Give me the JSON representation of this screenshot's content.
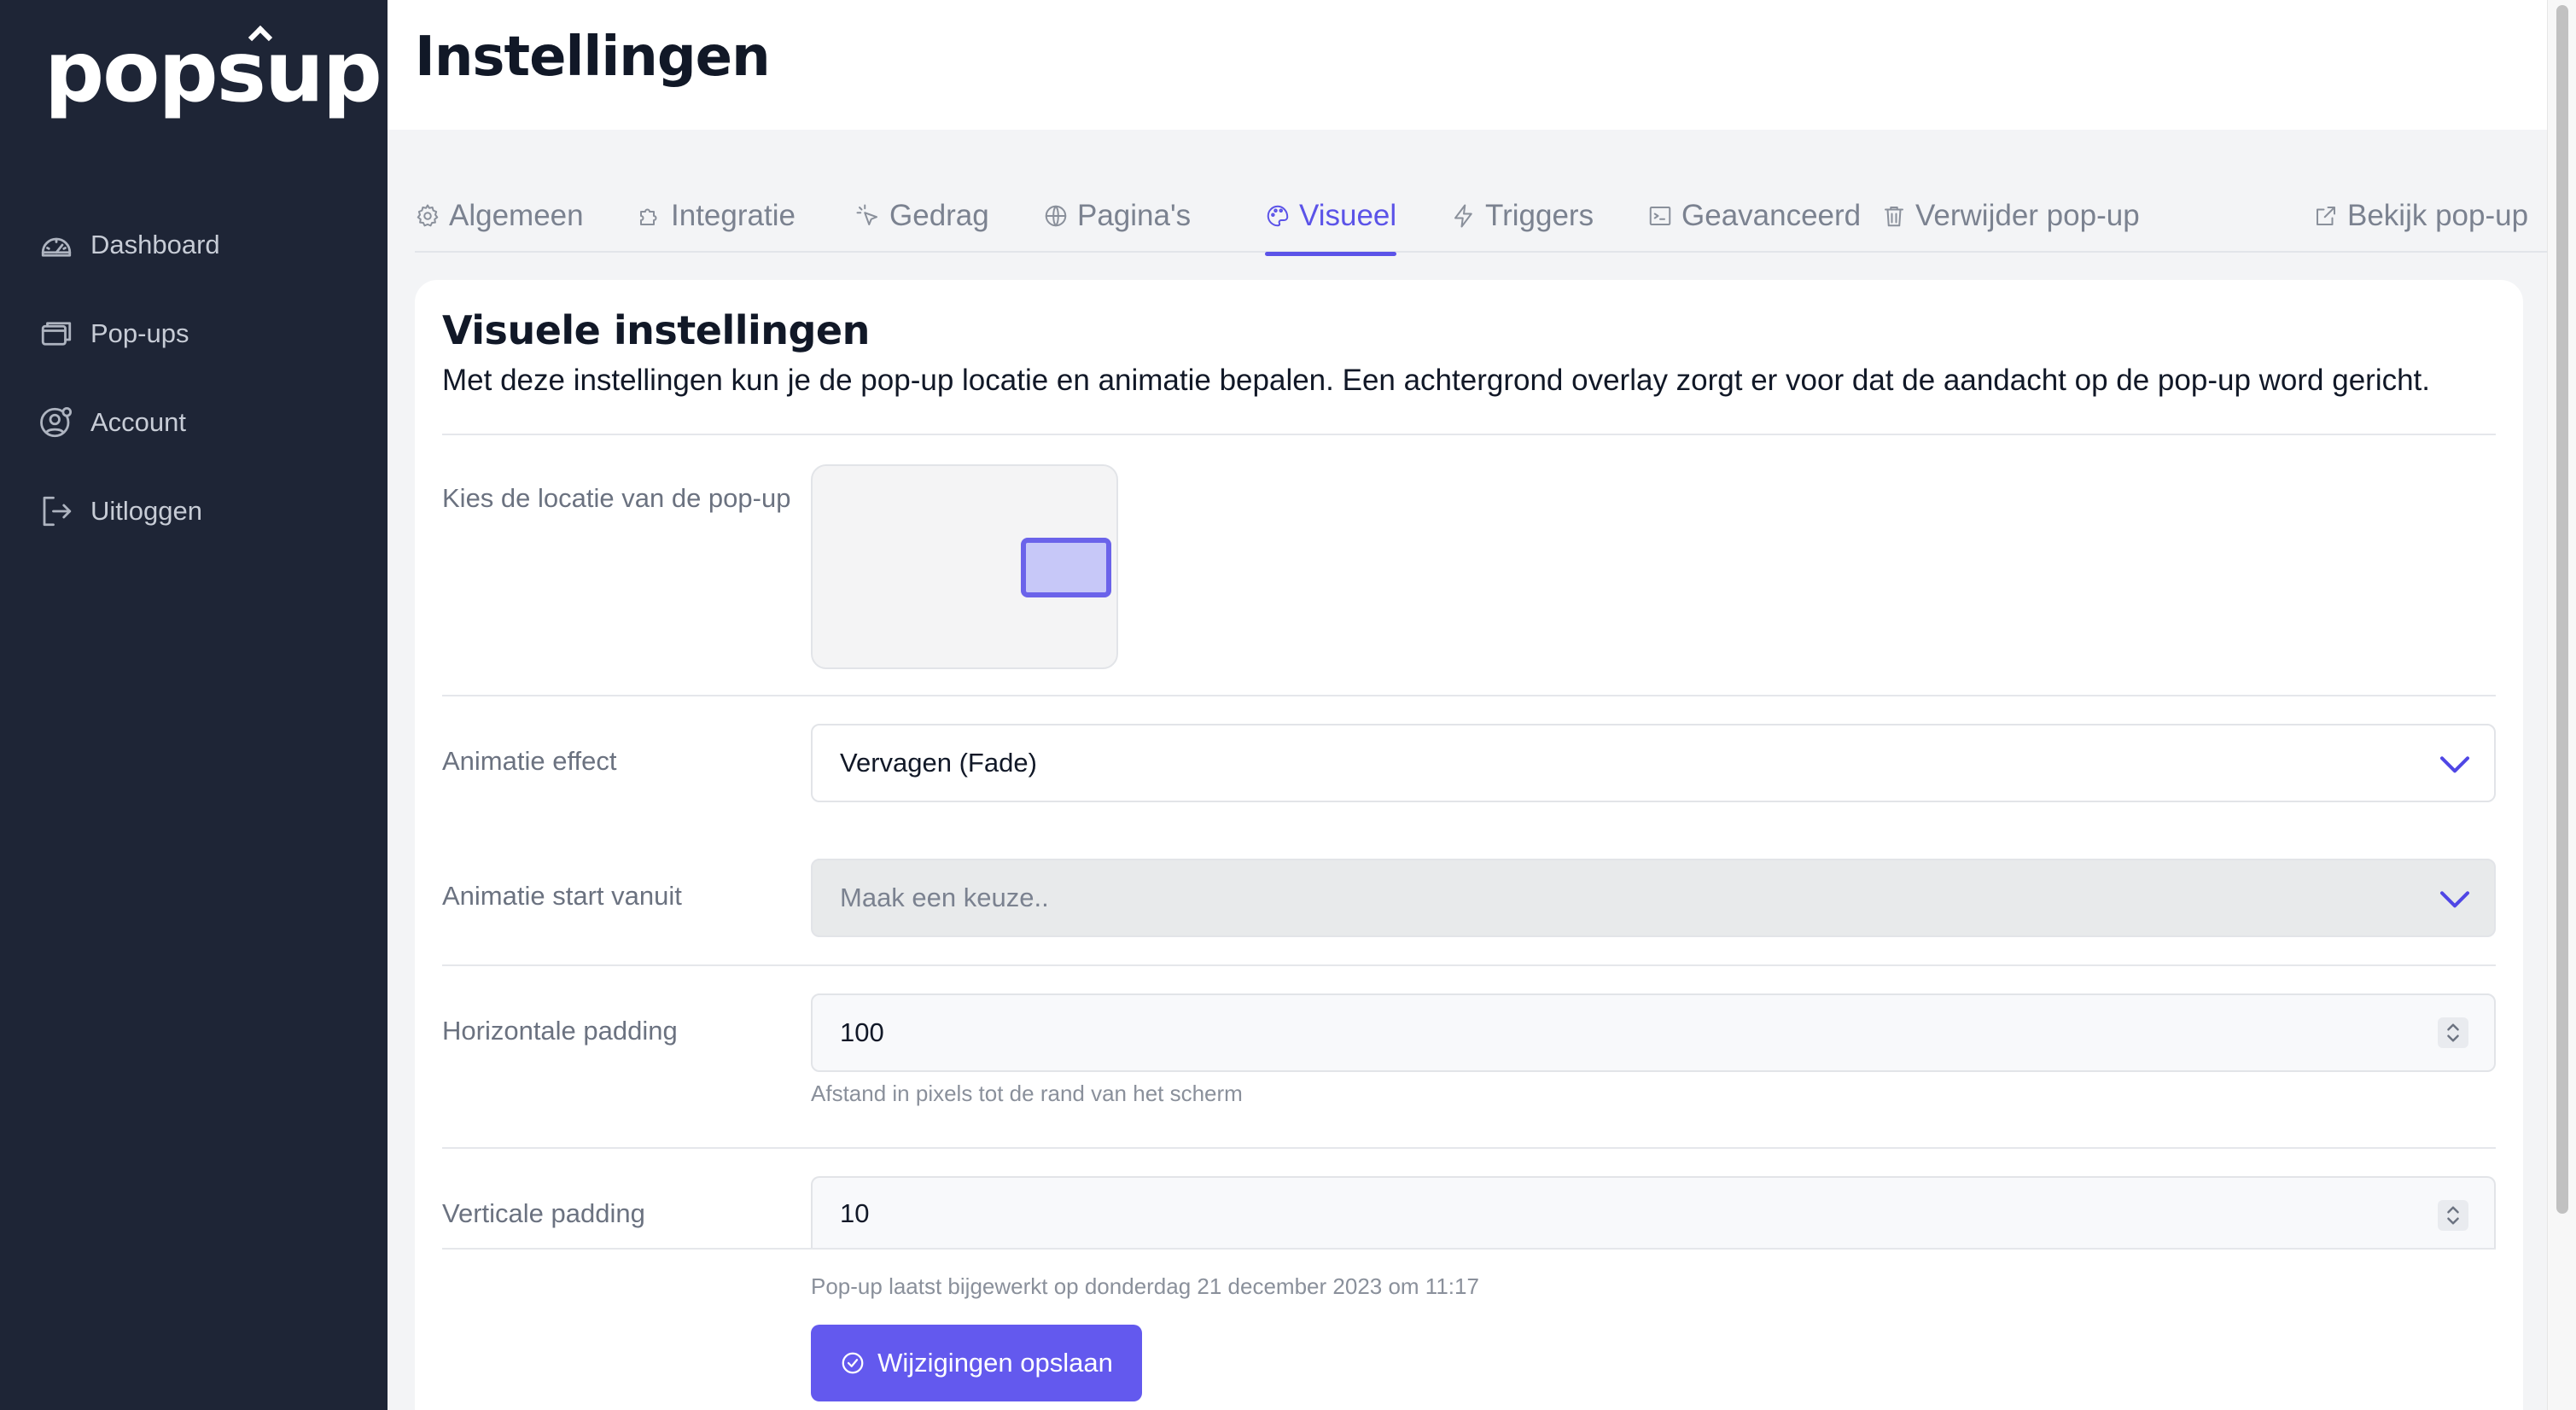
{
  "app": {
    "logo_text": "popsup"
  },
  "sidebar": {
    "items": [
      {
        "label": "Dashboard",
        "icon": "gauge-icon"
      },
      {
        "label": "Pop-ups",
        "icon": "windows-icon"
      },
      {
        "label": "Account",
        "icon": "user-gear-icon"
      },
      {
        "label": "Uitloggen",
        "icon": "logout-icon"
      }
    ]
  },
  "header": {
    "title": "Instellingen"
  },
  "tabs": [
    {
      "label": "Algemeen",
      "icon": "gear-icon",
      "active": false
    },
    {
      "label": "Integratie",
      "icon": "puzzle-icon",
      "active": false
    },
    {
      "label": "Gedrag",
      "icon": "pointer-icon",
      "active": false
    },
    {
      "label": "Pagina's",
      "icon": "globe-icon",
      "active": false
    },
    {
      "label": "Visueel",
      "icon": "palette-icon",
      "active": true
    },
    {
      "label": "Triggers",
      "icon": "bolt-icon",
      "active": false
    },
    {
      "label": "Geavanceerd",
      "icon": "terminal-icon",
      "active": false
    },
    {
      "label": "Verwijder pop-up",
      "icon": "trash-icon",
      "active": false
    },
    {
      "label": "Bekijk pop-up",
      "icon": "external-link-icon",
      "active": false
    }
  ],
  "card": {
    "title": "Visuele instellingen",
    "description": "Met deze instellingen kun je de pop-up locatie en animatie bepalen. Een achtergrond overlay zorgt er voor dat de aandacht op de pop-up word gericht."
  },
  "form": {
    "location_label": "Kies de locatie van de pop-up",
    "location_value": "middle-right",
    "animation_effect_label": "Animatie effect",
    "animation_effect_value": "Vervagen (Fade)",
    "animation_start_label": "Animatie start vanuit",
    "animation_start_placeholder": "Maak een keuze..",
    "horizontal_padding_label": "Horizontale padding",
    "horizontal_padding_value": "100",
    "horizontal_padding_hint": "Afstand in pixels tot de rand van het scherm",
    "vertical_padding_label": "Verticale padding",
    "vertical_padding_value": "10",
    "last_updated": "Pop-up laatst bijgewerkt op donderdag 21 december 2023 om 11:17",
    "save_label": "Wijzigingen opslaan"
  },
  "colors": {
    "sidebar_bg": "#1e2536",
    "accent": "#5b53e8",
    "button": "#6359ee"
  }
}
